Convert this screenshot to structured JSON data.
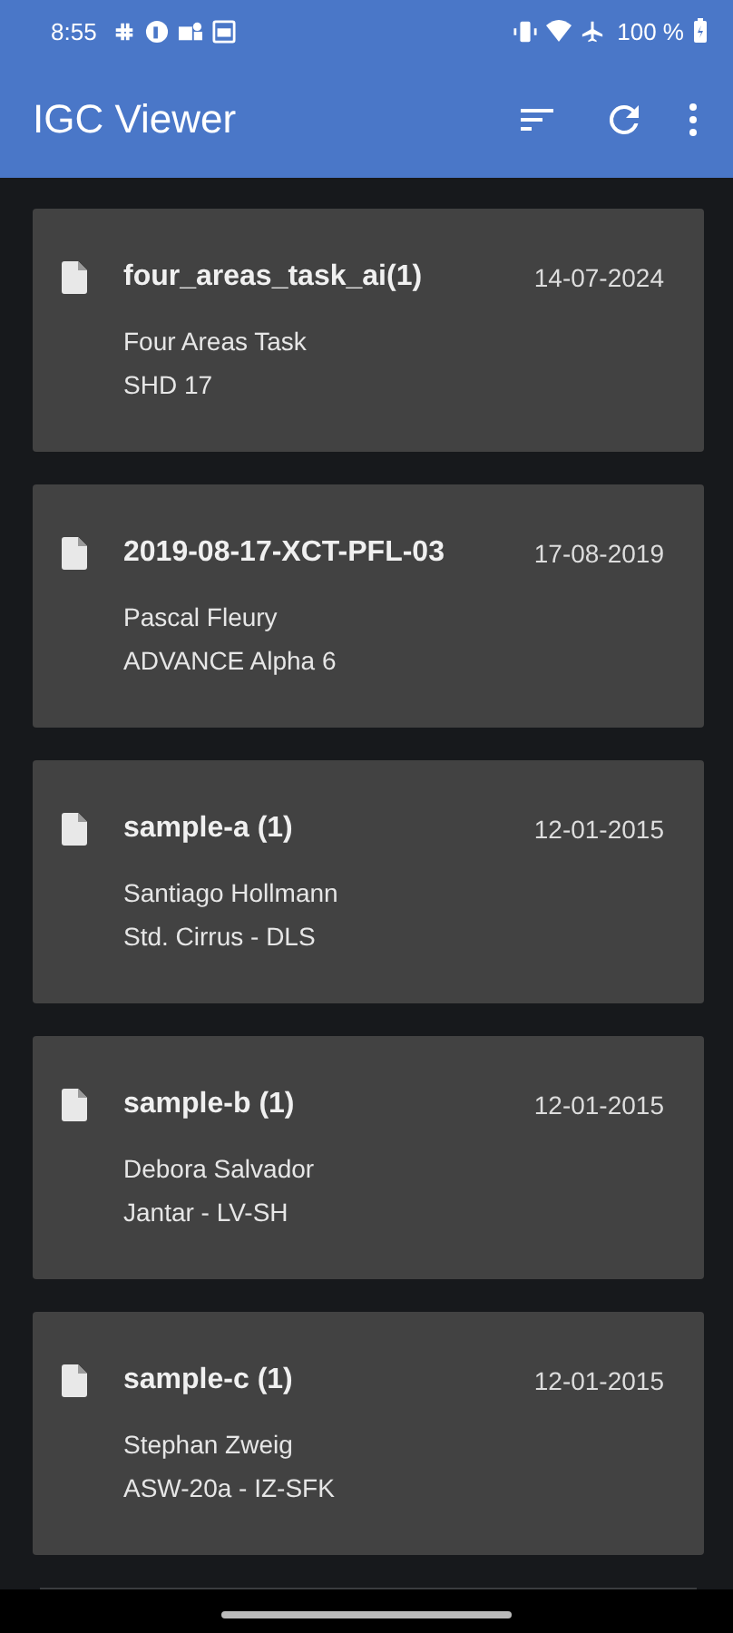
{
  "status_bar": {
    "time": "8:55",
    "battery": "100 %"
  },
  "app_bar": {
    "title": "IGC Viewer"
  },
  "flights": [
    {
      "file": "four_areas_task_ai(1)",
      "date": "14-07-2024",
      "pilot": "Four Areas Task",
      "glider": "SHD 17"
    },
    {
      "file": "2019-08-17-XCT-PFL-03",
      "date": "17-08-2019",
      "pilot": "Pascal Fleury",
      "glider": "ADVANCE Alpha 6"
    },
    {
      "file": "sample-a (1)",
      "date": "12-01-2015",
      "pilot": "Santiago Hollmann",
      "glider": "Std. Cirrus - DLS"
    },
    {
      "file": "sample-b (1)",
      "date": "12-01-2015",
      "pilot": "Debora Salvador",
      "glider": "Jantar - LV-SH"
    },
    {
      "file": "sample-c (1)",
      "date": "12-01-2015",
      "pilot": "Stephan Zweig",
      "glider": "ASW-20a - IZ-SFK"
    }
  ]
}
